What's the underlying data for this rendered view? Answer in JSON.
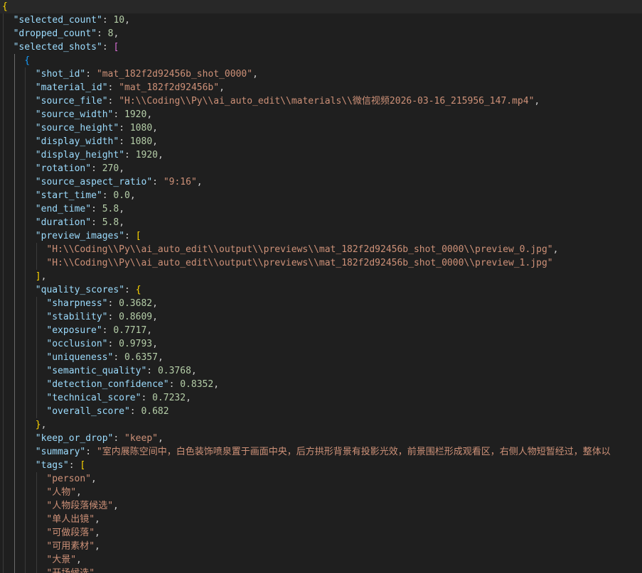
{
  "editor": {
    "language": "json",
    "lines": [
      {
        "indent": 0,
        "tokens": [
          {
            "t": "{",
            "c": "b0"
          }
        ]
      },
      {
        "indent": 1,
        "tokens": [
          {
            "t": "\"selected_count\"",
            "c": "key"
          },
          {
            "t": ": ",
            "c": "pun"
          },
          {
            "t": "10",
            "c": "num"
          },
          {
            "t": ",",
            "c": "pun"
          }
        ]
      },
      {
        "indent": 1,
        "tokens": [
          {
            "t": "\"dropped_count\"",
            "c": "key"
          },
          {
            "t": ": ",
            "c": "pun"
          },
          {
            "t": "8",
            "c": "num"
          },
          {
            "t": ",",
            "c": "pun"
          }
        ]
      },
      {
        "indent": 1,
        "tokens": [
          {
            "t": "\"selected_shots\"",
            "c": "key"
          },
          {
            "t": ": ",
            "c": "pun"
          },
          {
            "t": "[",
            "c": "b1"
          }
        ]
      },
      {
        "indent": 2,
        "tokens": [
          {
            "t": "{",
            "c": "b2"
          }
        ]
      },
      {
        "indent": 3,
        "tokens": [
          {
            "t": "\"shot_id\"",
            "c": "key"
          },
          {
            "t": ": ",
            "c": "pun"
          },
          {
            "t": "\"mat_182f2d92456b_shot_0000\"",
            "c": "str"
          },
          {
            "t": ",",
            "c": "pun"
          }
        ]
      },
      {
        "indent": 3,
        "tokens": [
          {
            "t": "\"material_id\"",
            "c": "key"
          },
          {
            "t": ": ",
            "c": "pun"
          },
          {
            "t": "\"mat_182f2d92456b\"",
            "c": "str"
          },
          {
            "t": ",",
            "c": "pun"
          }
        ]
      },
      {
        "indent": 3,
        "tokens": [
          {
            "t": "\"source_file\"",
            "c": "key"
          },
          {
            "t": ": ",
            "c": "pun"
          },
          {
            "t": "\"H:\\\\Coding\\\\Py\\\\ai_auto_edit\\\\materials\\\\微信视频2026-03-16_215956_147.mp4\"",
            "c": "str"
          },
          {
            "t": ",",
            "c": "pun"
          }
        ]
      },
      {
        "indent": 3,
        "tokens": [
          {
            "t": "\"source_width\"",
            "c": "key"
          },
          {
            "t": ": ",
            "c": "pun"
          },
          {
            "t": "1920",
            "c": "num"
          },
          {
            "t": ",",
            "c": "pun"
          }
        ]
      },
      {
        "indent": 3,
        "tokens": [
          {
            "t": "\"source_height\"",
            "c": "key"
          },
          {
            "t": ": ",
            "c": "pun"
          },
          {
            "t": "1080",
            "c": "num"
          },
          {
            "t": ",",
            "c": "pun"
          }
        ]
      },
      {
        "indent": 3,
        "tokens": [
          {
            "t": "\"display_width\"",
            "c": "key"
          },
          {
            "t": ": ",
            "c": "pun"
          },
          {
            "t": "1080",
            "c": "num"
          },
          {
            "t": ",",
            "c": "pun"
          }
        ]
      },
      {
        "indent": 3,
        "tokens": [
          {
            "t": "\"display_height\"",
            "c": "key"
          },
          {
            "t": ": ",
            "c": "pun"
          },
          {
            "t": "1920",
            "c": "num"
          },
          {
            "t": ",",
            "c": "pun"
          }
        ]
      },
      {
        "indent": 3,
        "tokens": [
          {
            "t": "\"rotation\"",
            "c": "key"
          },
          {
            "t": ": ",
            "c": "pun"
          },
          {
            "t": "270",
            "c": "num"
          },
          {
            "t": ",",
            "c": "pun"
          }
        ]
      },
      {
        "indent": 3,
        "tokens": [
          {
            "t": "\"source_aspect_ratio\"",
            "c": "key"
          },
          {
            "t": ": ",
            "c": "pun"
          },
          {
            "t": "\"9:16\"",
            "c": "str"
          },
          {
            "t": ",",
            "c": "pun"
          }
        ]
      },
      {
        "indent": 3,
        "tokens": [
          {
            "t": "\"start_time\"",
            "c": "key"
          },
          {
            "t": ": ",
            "c": "pun"
          },
          {
            "t": "0.0",
            "c": "num"
          },
          {
            "t": ",",
            "c": "pun"
          }
        ]
      },
      {
        "indent": 3,
        "tokens": [
          {
            "t": "\"end_time\"",
            "c": "key"
          },
          {
            "t": ": ",
            "c": "pun"
          },
          {
            "t": "5.8",
            "c": "num"
          },
          {
            "t": ",",
            "c": "pun"
          }
        ]
      },
      {
        "indent": 3,
        "tokens": [
          {
            "t": "\"duration\"",
            "c": "key"
          },
          {
            "t": ": ",
            "c": "pun"
          },
          {
            "t": "5.8",
            "c": "num"
          },
          {
            "t": ",",
            "c": "pun"
          }
        ]
      },
      {
        "indent": 3,
        "tokens": [
          {
            "t": "\"preview_images\"",
            "c": "key"
          },
          {
            "t": ": ",
            "c": "pun"
          },
          {
            "t": "[",
            "c": "b0"
          }
        ]
      },
      {
        "indent": 4,
        "tokens": [
          {
            "t": "\"H:\\\\Coding\\\\Py\\\\ai_auto_edit\\\\output\\\\previews\\\\mat_182f2d92456b_shot_0000\\\\preview_0.jpg\"",
            "c": "str"
          },
          {
            "t": ",",
            "c": "pun"
          }
        ]
      },
      {
        "indent": 4,
        "tokens": [
          {
            "t": "\"H:\\\\Coding\\\\Py\\\\ai_auto_edit\\\\output\\\\previews\\\\mat_182f2d92456b_shot_0000\\\\preview_1.jpg\"",
            "c": "str"
          }
        ]
      },
      {
        "indent": 3,
        "tokens": [
          {
            "t": "]",
            "c": "b0"
          },
          {
            "t": ",",
            "c": "pun"
          }
        ]
      },
      {
        "indent": 3,
        "tokens": [
          {
            "t": "\"quality_scores\"",
            "c": "key"
          },
          {
            "t": ": ",
            "c": "pun"
          },
          {
            "t": "{",
            "c": "b0"
          }
        ]
      },
      {
        "indent": 4,
        "tokens": [
          {
            "t": "\"sharpness\"",
            "c": "key"
          },
          {
            "t": ": ",
            "c": "pun"
          },
          {
            "t": "0.3682",
            "c": "num"
          },
          {
            "t": ",",
            "c": "pun"
          }
        ]
      },
      {
        "indent": 4,
        "tokens": [
          {
            "t": "\"stability\"",
            "c": "key"
          },
          {
            "t": ": ",
            "c": "pun"
          },
          {
            "t": "0.8609",
            "c": "num"
          },
          {
            "t": ",",
            "c": "pun"
          }
        ]
      },
      {
        "indent": 4,
        "tokens": [
          {
            "t": "\"exposure\"",
            "c": "key"
          },
          {
            "t": ": ",
            "c": "pun"
          },
          {
            "t": "0.7717",
            "c": "num"
          },
          {
            "t": ",",
            "c": "pun"
          }
        ]
      },
      {
        "indent": 4,
        "tokens": [
          {
            "t": "\"occlusion\"",
            "c": "key"
          },
          {
            "t": ": ",
            "c": "pun"
          },
          {
            "t": "0.9793",
            "c": "num"
          },
          {
            "t": ",",
            "c": "pun"
          }
        ]
      },
      {
        "indent": 4,
        "tokens": [
          {
            "t": "\"uniqueness\"",
            "c": "key"
          },
          {
            "t": ": ",
            "c": "pun"
          },
          {
            "t": "0.6357",
            "c": "num"
          },
          {
            "t": ",",
            "c": "pun"
          }
        ]
      },
      {
        "indent": 4,
        "tokens": [
          {
            "t": "\"semantic_quality\"",
            "c": "key"
          },
          {
            "t": ": ",
            "c": "pun"
          },
          {
            "t": "0.3768",
            "c": "num"
          },
          {
            "t": ",",
            "c": "pun"
          }
        ]
      },
      {
        "indent": 4,
        "tokens": [
          {
            "t": "\"detection_confidence\"",
            "c": "key"
          },
          {
            "t": ": ",
            "c": "pun"
          },
          {
            "t": "0.8352",
            "c": "num"
          },
          {
            "t": ",",
            "c": "pun"
          }
        ]
      },
      {
        "indent": 4,
        "tokens": [
          {
            "t": "\"technical_score\"",
            "c": "key"
          },
          {
            "t": ": ",
            "c": "pun"
          },
          {
            "t": "0.7232",
            "c": "num"
          },
          {
            "t": ",",
            "c": "pun"
          }
        ]
      },
      {
        "indent": 4,
        "tokens": [
          {
            "t": "\"overall_score\"",
            "c": "key"
          },
          {
            "t": ": ",
            "c": "pun"
          },
          {
            "t": "0.682",
            "c": "num"
          }
        ]
      },
      {
        "indent": 3,
        "tokens": [
          {
            "t": "}",
            "c": "b0"
          },
          {
            "t": ",",
            "c": "pun"
          }
        ]
      },
      {
        "indent": 3,
        "tokens": [
          {
            "t": "\"keep_or_drop\"",
            "c": "key"
          },
          {
            "t": ": ",
            "c": "pun"
          },
          {
            "t": "\"keep\"",
            "c": "str"
          },
          {
            "t": ",",
            "c": "pun"
          }
        ]
      },
      {
        "indent": 3,
        "tokens": [
          {
            "t": "\"summary\"",
            "c": "key"
          },
          {
            "t": ": ",
            "c": "pun"
          },
          {
            "t": "\"室内展陈空间中，白色装饰喷泉置于画面中央，后方拱形背景有投影光效，前景围栏形成观看区，右侧人物短暂经过，整体以",
            "c": "str"
          }
        ]
      },
      {
        "indent": 3,
        "tokens": [
          {
            "t": "\"tags\"",
            "c": "key"
          },
          {
            "t": ": ",
            "c": "pun"
          },
          {
            "t": "[",
            "c": "b0"
          }
        ]
      },
      {
        "indent": 4,
        "tokens": [
          {
            "t": "\"person\"",
            "c": "str"
          },
          {
            "t": ",",
            "c": "pun"
          }
        ]
      },
      {
        "indent": 4,
        "tokens": [
          {
            "t": "\"人物\"",
            "c": "str"
          },
          {
            "t": ",",
            "c": "pun"
          }
        ]
      },
      {
        "indent": 4,
        "tokens": [
          {
            "t": "\"人物段落候选\"",
            "c": "str"
          },
          {
            "t": ",",
            "c": "pun"
          }
        ]
      },
      {
        "indent": 4,
        "tokens": [
          {
            "t": "\"单人出镜\"",
            "c": "str"
          },
          {
            "t": ",",
            "c": "pun"
          }
        ]
      },
      {
        "indent": 4,
        "tokens": [
          {
            "t": "\"可做段落\"",
            "c": "str"
          },
          {
            "t": ",",
            "c": "pun"
          }
        ]
      },
      {
        "indent": 4,
        "tokens": [
          {
            "t": "\"可用素材\"",
            "c": "str"
          },
          {
            "t": ",",
            "c": "pun"
          }
        ]
      },
      {
        "indent": 4,
        "tokens": [
          {
            "t": "\"大景\"",
            "c": "str"
          },
          {
            "t": ",",
            "c": "pun"
          }
        ]
      },
      {
        "indent": 4,
        "tokens": [
          {
            "t": "\"开场候选\"",
            "c": "str"
          },
          {
            "t": ",",
            "c": "pun"
          }
        ]
      }
    ]
  },
  "theme": {
    "background": "#1f1f1f",
    "current_line": "#282828",
    "key_color": "#9cdcfe",
    "string_color": "#ce9178",
    "number_color": "#b5cea8",
    "bracket_colors": [
      "#ffd700",
      "#da70d6",
      "#179fff"
    ]
  }
}
